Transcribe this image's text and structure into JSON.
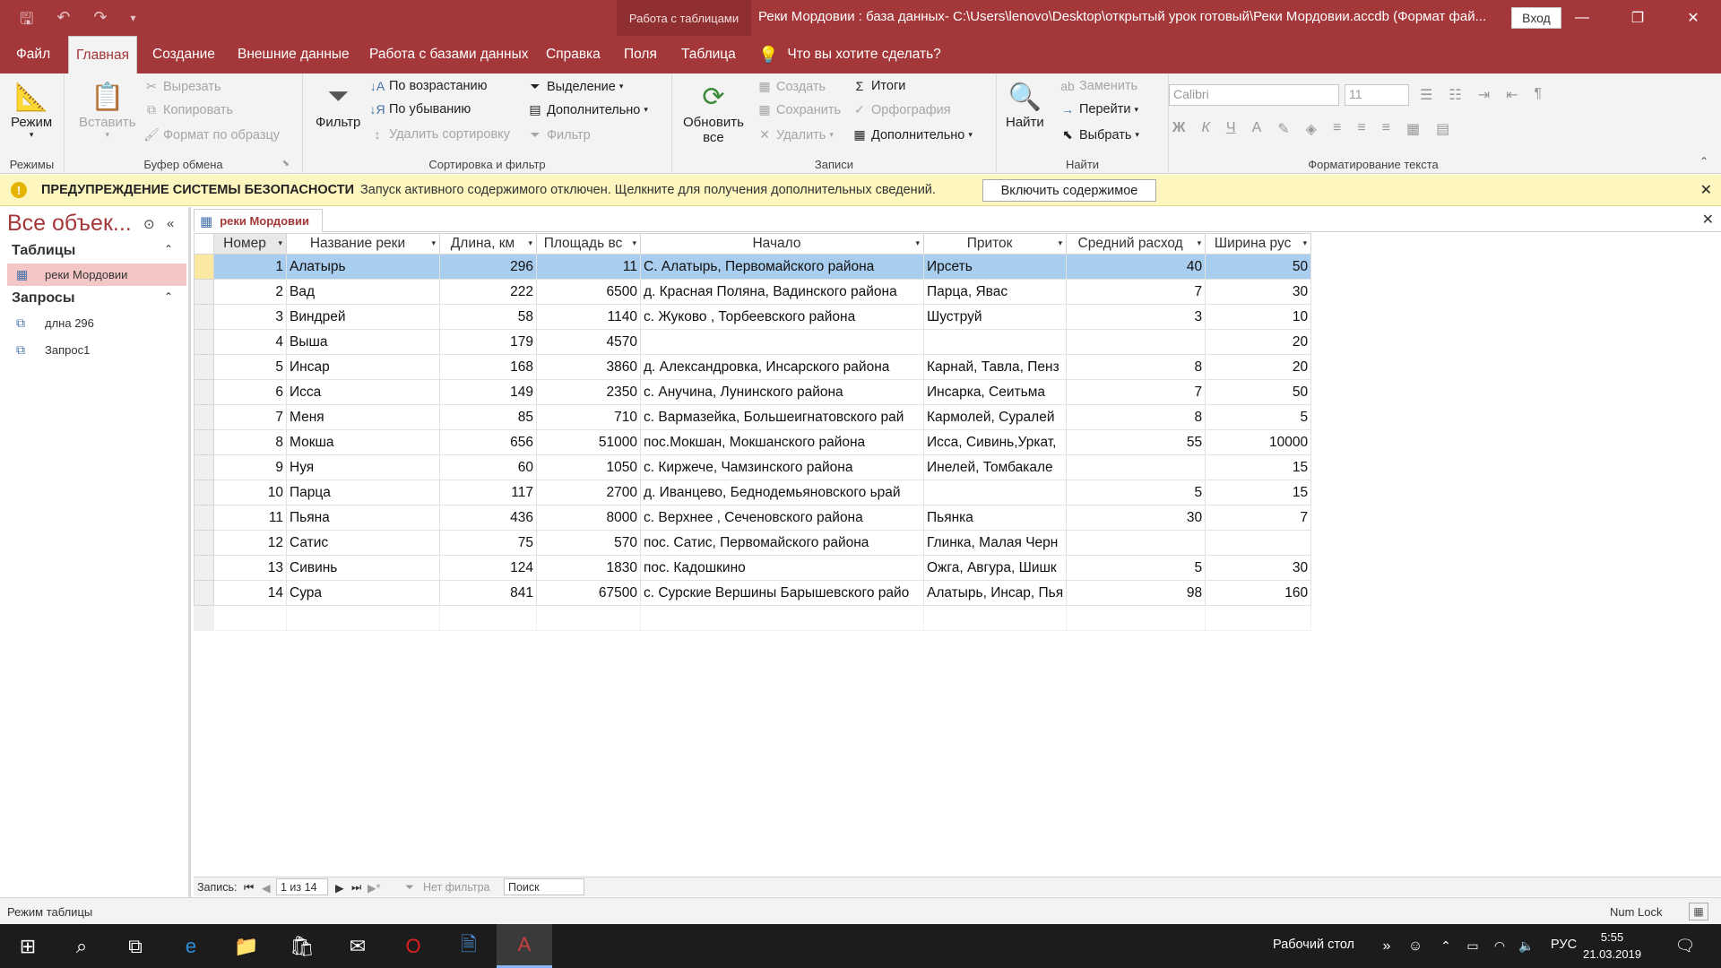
{
  "titlebar": {
    "context_tab": "Работа с таблицами",
    "title": "Реки Мордовии : база данных- C:\\Users\\lenovo\\Desktop\\открытый урок готовый\\Реки Мордовии.accdb (Формат фай...",
    "signin": "Вход"
  },
  "tabs": [
    "Файл",
    "Главная",
    "Создание",
    "Внешние данные",
    "Работа с базами данных",
    "Справка",
    "Поля",
    "Таблица"
  ],
  "tellme": "Что вы хотите сделать?",
  "ribbon": {
    "views": {
      "label": "Режимы",
      "mode": "Режим"
    },
    "clipboard": {
      "label": "Буфер обмена",
      "paste": "Вставить",
      "cut": "Вырезать",
      "copy": "Копировать",
      "format_painter": "Формат по образцу"
    },
    "sort": {
      "label": "Сортировка и фильтр",
      "filter": "Фильтр",
      "asc": "По возрастанию",
      "desc": "По убыванию",
      "remove_sort": "Удалить сортировку",
      "selection": "Выделение",
      "advanced": "Дополнительно",
      "toggle_filter": "Фильтр"
    },
    "records": {
      "label": "Записи",
      "refresh": "Обновить",
      "refresh2": "все",
      "new": "Создать",
      "save": "Сохранить",
      "delete": "Удалить",
      "totals": "Итоги",
      "spelling": "Орфография",
      "more": "Дополнительно"
    },
    "find": {
      "label": "Найти",
      "find": "Найти",
      "replace": "Заменить",
      "goto": "Перейти",
      "select": "Выбрать"
    },
    "text": {
      "label": "Форматирование текста",
      "font": "Calibri",
      "size": "11",
      "bold": "Ж",
      "italic": "К",
      "underline": "Ч"
    }
  },
  "security": {
    "title": "ПРЕДУПРЕЖДЕНИЕ СИСТЕМЫ БЕЗОПАСНОСТИ",
    "message": "Запуск активного содержимого отключен. Щелкните для получения дополнительных сведений.",
    "button": "Включить содержимое"
  },
  "nav": {
    "title": "Все объек...",
    "sections": [
      {
        "name": "Таблицы",
        "items": [
          "реки Мордовии"
        ]
      },
      {
        "name": "Запросы",
        "items": [
          "длна 296",
          "Запрос1"
        ]
      }
    ]
  },
  "doc": {
    "tab": "реки Мордовии"
  },
  "table": {
    "columns": [
      "Номер",
      "Название реки",
      "Длина, км",
      "Площадь вс",
      "Начало",
      "Приток",
      "Средний расход",
      "Ширина рус"
    ],
    "rows": [
      [
        "1",
        "Алатырь",
        "296",
        "11",
        "С. Алатырь, Первомайского района",
        "Ирсеть",
        "40",
        "50"
      ],
      [
        "2",
        "Вад",
        "222",
        "6500",
        "д.  Красная Поляна, Вадинского района",
        "Парца, Явас",
        "7",
        "30"
      ],
      [
        "3",
        "Виндрей",
        "58",
        "1140",
        "с. Жуково , Торбеевского района",
        "Шуструй",
        "3",
        "10"
      ],
      [
        "4",
        "Выша",
        "179",
        "4570",
        "",
        "",
        "",
        "20"
      ],
      [
        "5",
        "Инсар",
        "168",
        "3860",
        "д. Александровка, Инсарского района",
        "Карнай, Тавла, Пенз",
        "8",
        "20"
      ],
      [
        "6",
        "Исса",
        "149",
        "2350",
        "с. Анучина, Лунинского района",
        "Инсарка, Сеитьма",
        "7",
        "50"
      ],
      [
        "7",
        "Меня",
        "85",
        "710",
        "с. Вармазейка, Большеигнатовского рай",
        "Кармолей, Суралей",
        "8",
        "5"
      ],
      [
        "8",
        "Мокша",
        "656",
        "51000",
        "пос.Мокшан, Мокшанского района",
        "Исса, Сивинь,Уркат,",
        "55",
        "10000"
      ],
      [
        "9",
        "Нуя",
        "60",
        "1050",
        "с. Киржече, Чамзинского района",
        "Инелей, Томбакале",
        "",
        "15"
      ],
      [
        "10",
        "Парца",
        "117",
        "2700",
        "д. Иванцево, Беднодемьяновского ьрай",
        "",
        "5",
        "15"
      ],
      [
        "11",
        "Пьяна",
        "436",
        "8000",
        "с. Верхнее , Сеченовского района",
        "Пьянка",
        "30",
        "7"
      ],
      [
        "12",
        "Сатис",
        "75",
        "570",
        "пос. Сатис, Первомайского района",
        "Глинка, Малая Черн",
        "",
        ""
      ],
      [
        "13",
        "Сивинь",
        "124",
        "1830",
        "пос. Кадошкино",
        "Ожга, Авгура, Шишк",
        "5",
        "30"
      ],
      [
        "14",
        "Сура",
        "841",
        "67500",
        "с. Сурские Вершины Барышевского райо",
        "Алатырь, Инсар, Пья",
        "98",
        "160"
      ]
    ]
  },
  "recnav": {
    "label": "Запись:",
    "position": "1 из 14",
    "filter": "Нет фильтра",
    "search": "Поиск"
  },
  "status": {
    "mode": "Режим таблицы",
    "numlock": "Num Lock"
  },
  "taskbar": {
    "desktop": "Рабочий стол",
    "lang": "РУС",
    "time": "5:55",
    "date": "21.03.2019"
  }
}
